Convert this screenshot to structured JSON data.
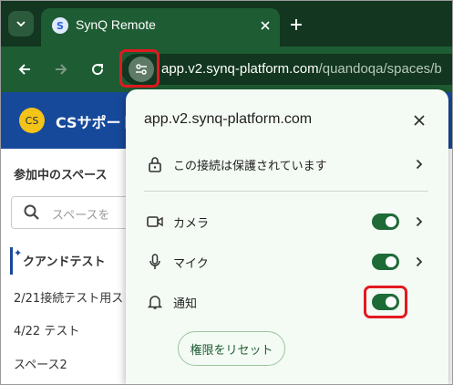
{
  "browser": {
    "tab_title": "SynQ Remote",
    "favicon_letter": "S",
    "url_host": "app.v2.synq-platform.com",
    "url_path": "/quandoqa/spaces/b"
  },
  "page": {
    "avatar_initials": "CS",
    "header_title": "CSサポート",
    "sidebar_heading": "参加中のスペース",
    "search_placeholder": "スペースを",
    "items": [
      "クアンドテスト",
      "2/21接続テスト用ス",
      "4/22 テスト",
      "スペース2"
    ]
  },
  "popup": {
    "title": "app.v2.synq-platform.com",
    "connection_label": "この接続は保護されています",
    "camera_label": "カメラ",
    "camera_enabled": true,
    "mic_label": "マイク",
    "mic_enabled": true,
    "notifications_label": "通知",
    "notifications_enabled": true,
    "reset_label": "権限をリセット"
  },
  "colors": {
    "browser_dark": "#12361f",
    "browser_toolbar": "#1e5c33",
    "page_header": "#17499b",
    "popup_bg": "#f4fbf4",
    "toggle_on": "#1e6b38",
    "highlight": "#e3191f"
  }
}
